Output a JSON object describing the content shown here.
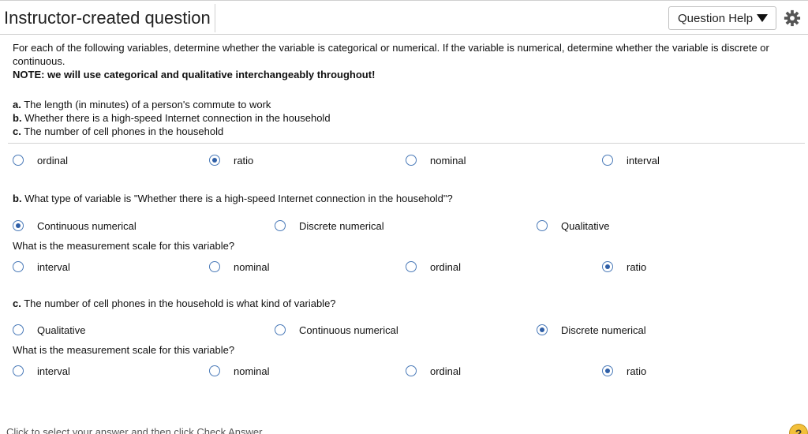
{
  "header": {
    "title": "Instructor-created question",
    "help_label": "Question Help"
  },
  "intro": {
    "text": "For each of the following variables, determine whether the variable is categorical or numerical. If the variable is numerical, determine whether the variable is discrete or continuous.",
    "note": "NOTE:  we will use categorical and qualitative interchangeably throughout!"
  },
  "items": [
    {
      "letter": "a.",
      "text": "The length (in minutes) of a person's commute to work"
    },
    {
      "letter": "b.",
      "text": "Whether there is a high-speed Internet connection in the household"
    },
    {
      "letter": "c.",
      "text": "The number of cell phones in the household"
    }
  ],
  "part_a": {
    "scale_options": [
      {
        "label": "ordinal",
        "checked": false
      },
      {
        "label": "ratio",
        "checked": true
      },
      {
        "label": "nominal",
        "checked": false
      },
      {
        "label": "interval",
        "checked": false
      }
    ]
  },
  "part_b": {
    "letter": "b.",
    "question": "What type of variable is  \"Whether there is a high-speed Internet connection in the household\"?",
    "type_options": [
      {
        "label": "Continuous numerical",
        "checked": true
      },
      {
        "label": "Discrete numerical",
        "checked": false
      },
      {
        "label": "Qualitative",
        "checked": false
      }
    ],
    "scale_question": "What is the measurement scale for this variable?",
    "scale_options": [
      {
        "label": "interval",
        "checked": false
      },
      {
        "label": "nominal",
        "checked": false
      },
      {
        "label": "ordinal",
        "checked": false
      },
      {
        "label": "ratio",
        "checked": true
      }
    ]
  },
  "part_c": {
    "letter": "c.",
    "question": "The number of cell phones in the household is what kind of variable?",
    "type_options": [
      {
        "label": "Qualitative",
        "checked": false
      },
      {
        "label": "Continuous numerical",
        "checked": false
      },
      {
        "label": "Discrete numerical",
        "checked": true
      }
    ],
    "scale_question": "What is the measurement scale for this variable?",
    "scale_options": [
      {
        "label": "interval",
        "checked": false
      },
      {
        "label": "nominal",
        "checked": false
      },
      {
        "label": "ordinal",
        "checked": false
      },
      {
        "label": "ratio",
        "checked": true
      }
    ]
  },
  "footer": {
    "instruction": "Click to select your answer and then click Check Answer.",
    "help_symbol": "?"
  },
  "colors": {
    "radio_border": "#4a7ab8",
    "radio_fill": "#2f5fa7",
    "help_circle": "#f3c03a"
  }
}
